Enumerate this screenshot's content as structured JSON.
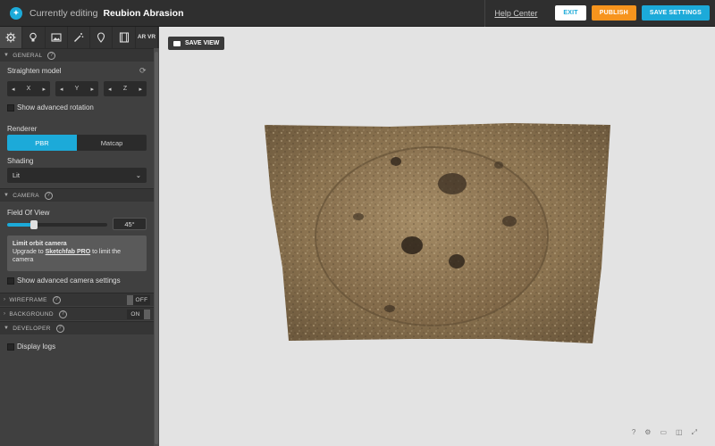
{
  "header": {
    "editing_label": "Currently editing",
    "model_name": "Reubion Abrasion",
    "help_center": "Help Center",
    "exit_label": "EXIT",
    "publish_label": "PUBLISH",
    "save_settings_label": "SAVE SETTINGS"
  },
  "tabs": [
    {
      "icon": "gear-icon"
    },
    {
      "icon": "lightbulb-icon"
    },
    {
      "icon": "image-icon"
    },
    {
      "icon": "magic-wand-icon"
    },
    {
      "icon": "map-pin-icon"
    },
    {
      "icon": "film-icon"
    },
    {
      "label": "AR VR"
    }
  ],
  "general": {
    "title": "GENERAL",
    "straighten_label": "Straighten model",
    "axes": [
      "X",
      "Y",
      "Z"
    ],
    "advanced_rotation": "Show advanced rotation",
    "renderer_label": "Renderer",
    "renderer_options": [
      "PBR",
      "Matcap"
    ],
    "shading_label": "Shading",
    "shading_value": "Lit"
  },
  "camera": {
    "title": "CAMERA",
    "fov_label": "Field Of View",
    "fov_value": "45°",
    "fov_fraction": 0.27,
    "limit_title": "Limit orbit camera",
    "limit_prefix": "Upgrade to",
    "limit_link": "Sketchfab PRO",
    "limit_suffix": "to limit the camera",
    "advanced_label": "Show advanced camera settings"
  },
  "wireframe": {
    "title": "WIREFRAME",
    "state": "OFF"
  },
  "background": {
    "title": "BACKGROUND",
    "state": "ON"
  },
  "developer": {
    "title": "DEVELOPER",
    "display_logs": "Display logs"
  },
  "viewport": {
    "save_view": "SAVE VIEW"
  },
  "colors": {
    "accent": "#1caad9",
    "publish": "#f7941d"
  }
}
